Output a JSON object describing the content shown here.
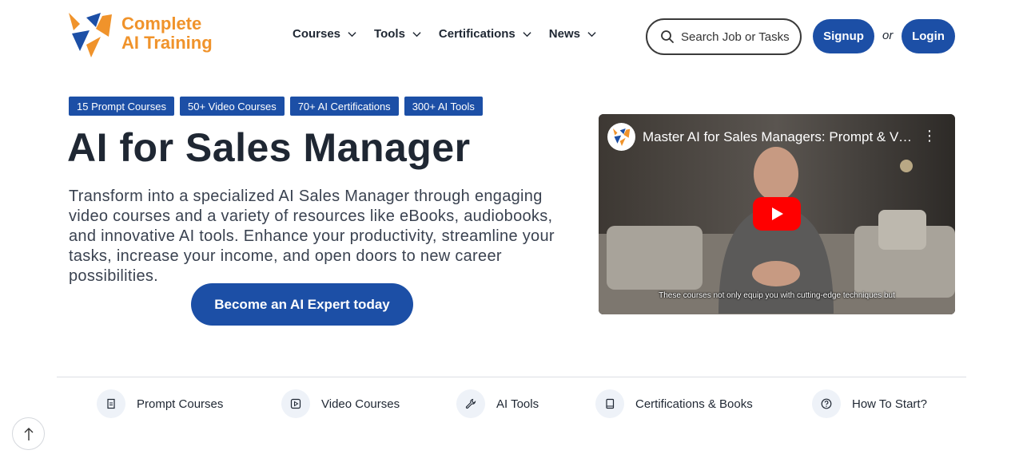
{
  "brand": {
    "line1": "Complete",
    "line2": "AI Training",
    "accent": "#f0932b",
    "primary": "#1c4fa6"
  },
  "nav": [
    {
      "label": "Courses"
    },
    {
      "label": "Tools"
    },
    {
      "label": "Certifications"
    },
    {
      "label": "News"
    }
  ],
  "search": {
    "placeholder": "Search Job or Tasks"
  },
  "auth": {
    "signup": "Signup",
    "or": "or",
    "login": "Login"
  },
  "badges": [
    "15 Prompt Courses",
    "50+ Video Courses",
    "70+ AI Certifications",
    "300+ AI Tools"
  ],
  "hero": {
    "title": "AI for Sales Manager",
    "description": "Transform into a specialized AI Sales Manager through engaging video courses and a variety of resources like eBooks, audiobooks, and innovative AI tools. Enhance your productivity, streamline your tasks, increase your income, and open doors to new career possibilities.",
    "cta": "Become an AI Expert today"
  },
  "video": {
    "title": "Master AI for Sales Managers: Prompt & Video Courses",
    "caption": "These courses not only equip you with cutting-edge techniques but",
    "menu": "⋮"
  },
  "features": [
    {
      "label": "Prompt Courses",
      "icon": "document-icon"
    },
    {
      "label": "Video Courses",
      "icon": "play-square-icon"
    },
    {
      "label": "AI Tools",
      "icon": "wrench-icon"
    },
    {
      "label": "Certifications & Books",
      "icon": "book-icon"
    },
    {
      "label": "How To Start?",
      "icon": "question-icon"
    }
  ]
}
